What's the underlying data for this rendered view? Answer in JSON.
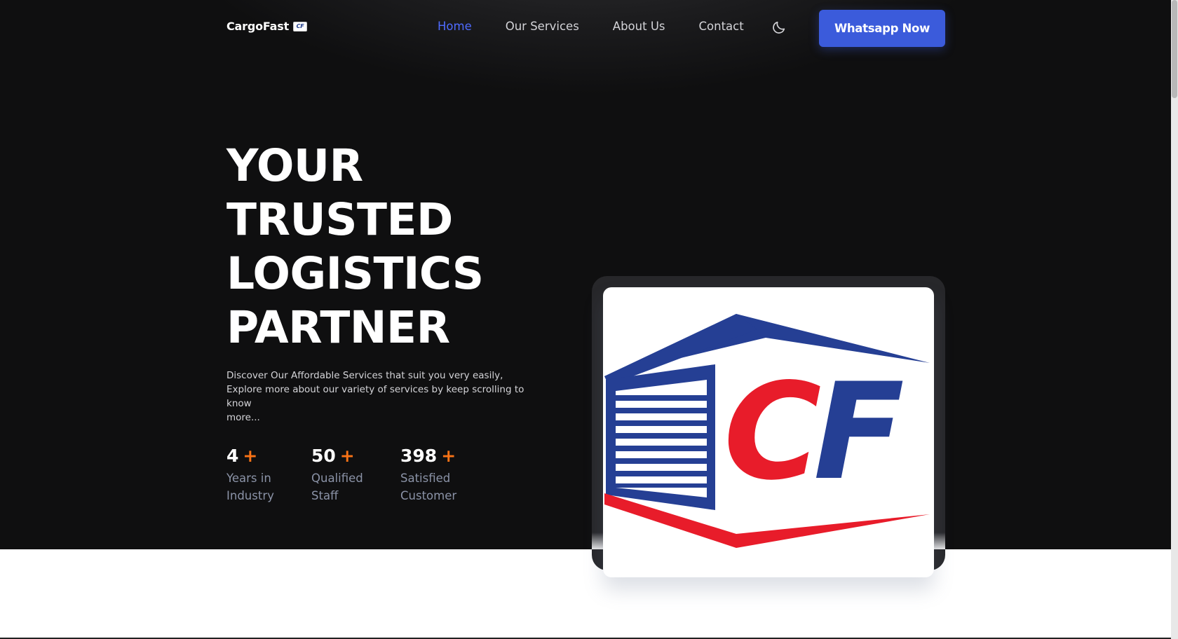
{
  "brand": {
    "name": "CargoFast",
    "flag_text": "CF"
  },
  "nav": {
    "items": [
      {
        "label": "Home",
        "active": true
      },
      {
        "label": "Our Services",
        "active": false
      },
      {
        "label": "About Us",
        "active": false
      },
      {
        "label": "Contact",
        "active": false
      }
    ],
    "theme_icon": "moon-icon",
    "cta_label": "Whatsapp Now"
  },
  "hero": {
    "headline_lines": [
      "YOUR",
      "TRUSTED",
      "LOGISTICS",
      "PARTNER"
    ],
    "description_lines": [
      "Discover Our Affordable Services that suit you very easily,",
      "Explore more about our variety of services by keep scrolling to know",
      "more..."
    ]
  },
  "stats": [
    {
      "value": "4",
      "suffix": "+",
      "label": "Years in Industry"
    },
    {
      "value": "50",
      "suffix": "+",
      "label": "Qualified Staff"
    },
    {
      "value": "398",
      "suffix": "+",
      "label": "Satisfied Customer"
    }
  ],
  "logo_image": {
    "letters": "CF",
    "colors": {
      "blue": "#253f94",
      "red": "#e81c2a"
    }
  },
  "colors": {
    "accent": "#3b5bdb",
    "nav_active": "#4f6bff",
    "plus": "#f97316",
    "hero_bg": "#0f0f10"
  }
}
